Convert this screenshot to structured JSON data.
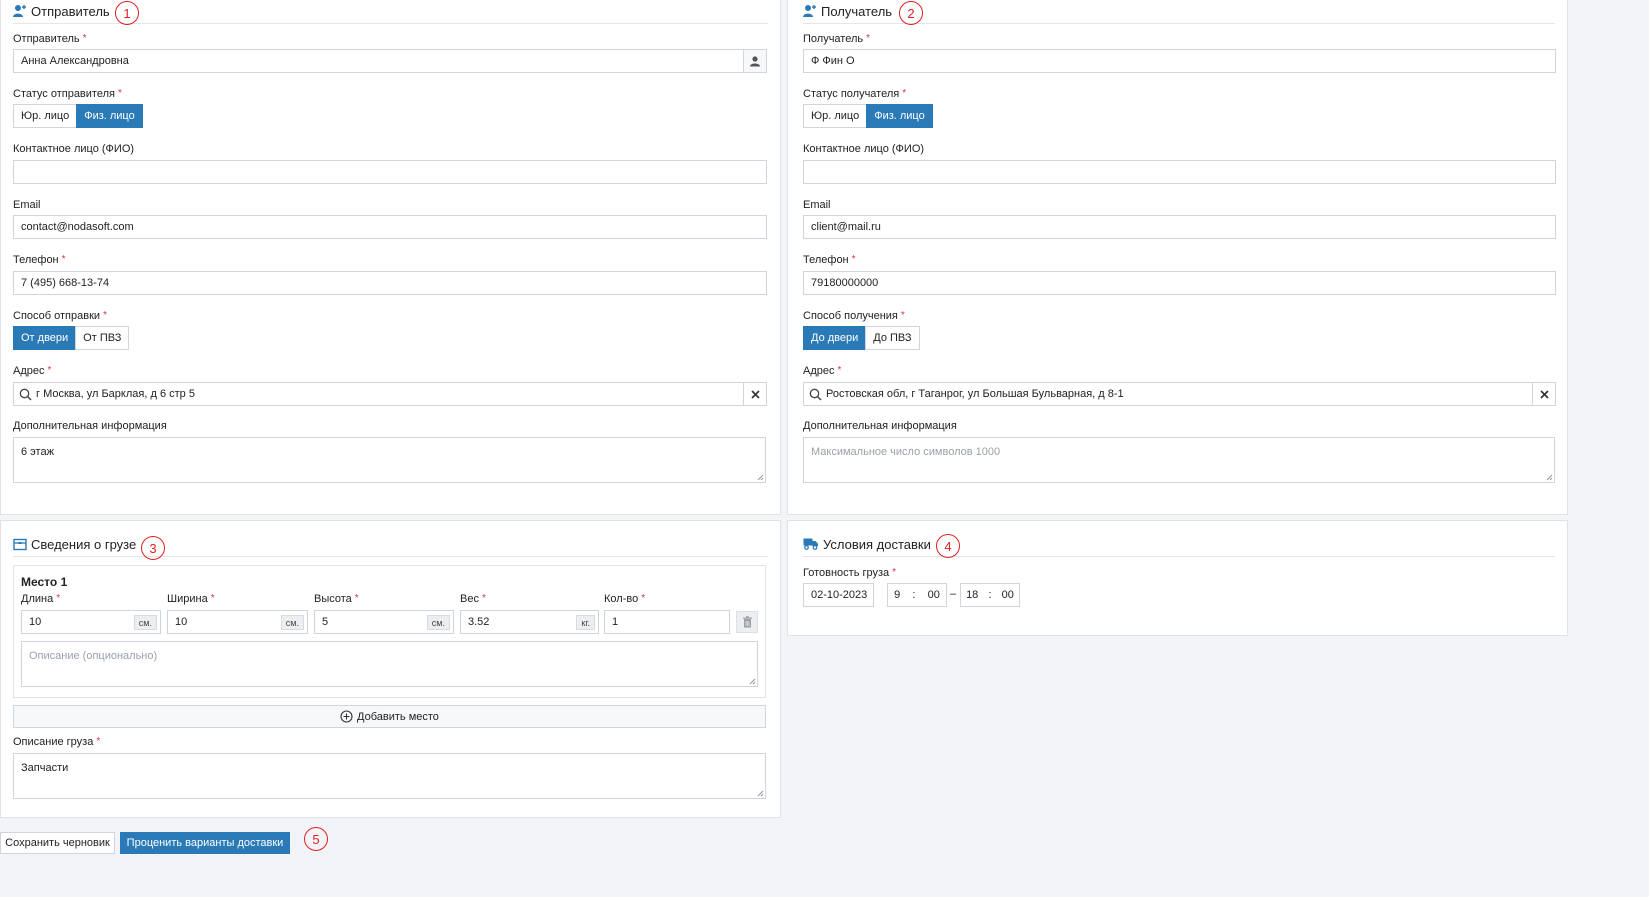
{
  "sender": {
    "title": "Отправитель",
    "badge": "1",
    "sender_label": "Отправитель",
    "sender_value": "Анна Александровна",
    "status_label": "Статус отправителя",
    "status_options": [
      "Юр. лицо",
      "Физ. лицо"
    ],
    "contact_label": "Контактное лицо (ФИО)",
    "contact_value": "",
    "email_label": "Email",
    "email_value": "contact@nodasoft.com",
    "phone_label": "Телефон",
    "phone_value": "7 (495) 668-13-74",
    "method_label": "Способ отправки",
    "method_options": [
      "От двери",
      "От ПВЗ"
    ],
    "address_label": "Адрес",
    "address_value": "г Москва, ул Барклая, д 6 стр 5",
    "extra_label": "Дополнительная информация",
    "extra_value": "6 этаж"
  },
  "recipient": {
    "title": "Получатель",
    "badge": "2",
    "recipient_label": "Получатель",
    "recipient_value": "Ф Фин О",
    "status_label": "Статус получателя",
    "status_options": [
      "Юр. лицо",
      "Физ. лицо"
    ],
    "contact_label": "Контактное лицо (ФИО)",
    "contact_value": "",
    "email_label": "Email",
    "email_value": "client@mail.ru",
    "phone_label": "Телефон",
    "phone_value": "79180000000",
    "method_label": "Способ получения",
    "method_options": [
      "До двери",
      "До ПВЗ"
    ],
    "address_label": "Адрес",
    "address_value": "Ростовская обл, г Таганрог, ул Большая Бульварная, д 8-1",
    "extra_label": "Дополнительная информация",
    "extra_placeholder": "Максимальное число символов 1000"
  },
  "cargo": {
    "title": "Сведения о грузе",
    "badge": "3",
    "place_title": "Место 1",
    "length_label": "Длина",
    "length_value": "10",
    "length_unit": "см.",
    "width_label": "Ширина",
    "width_value": "10",
    "width_unit": "см.",
    "height_label": "Высота",
    "height_value": "5",
    "height_unit": "см.",
    "weight_label": "Вес",
    "weight_value": "3.52",
    "weight_unit": "кг.",
    "qty_label": "Кол-во",
    "qty_value": "1",
    "place_desc_placeholder": "Описание (опционально)",
    "add_place_label": "Добавить место",
    "desc_label": "Описание груза",
    "desc_value": "Запчасти"
  },
  "delivery": {
    "title": "Условия доставки",
    "badge": "4",
    "ready_label": "Готовность груза",
    "date_value": "02-10-2023",
    "from_hour": "9",
    "from_min": "00",
    "dash": "–",
    "to_hour": "18",
    "to_min": "00",
    "colon": ":"
  },
  "footer": {
    "save_draft": "Сохранить черновик",
    "estimate": "Проценить варианты доставки",
    "badge": "5"
  },
  "colors": {
    "accent": "#2a7ab8",
    "required": "#d9363e",
    "badge": "#e02020"
  },
  "icons": {
    "person_plus": "person-plus-icon",
    "contact_card": "contact-card-icon",
    "search": "search-icon",
    "clear": "close-icon",
    "box": "box-icon",
    "truck": "truck-icon",
    "trash": "trash-icon",
    "plus_circle": "plus-circle-icon"
  }
}
